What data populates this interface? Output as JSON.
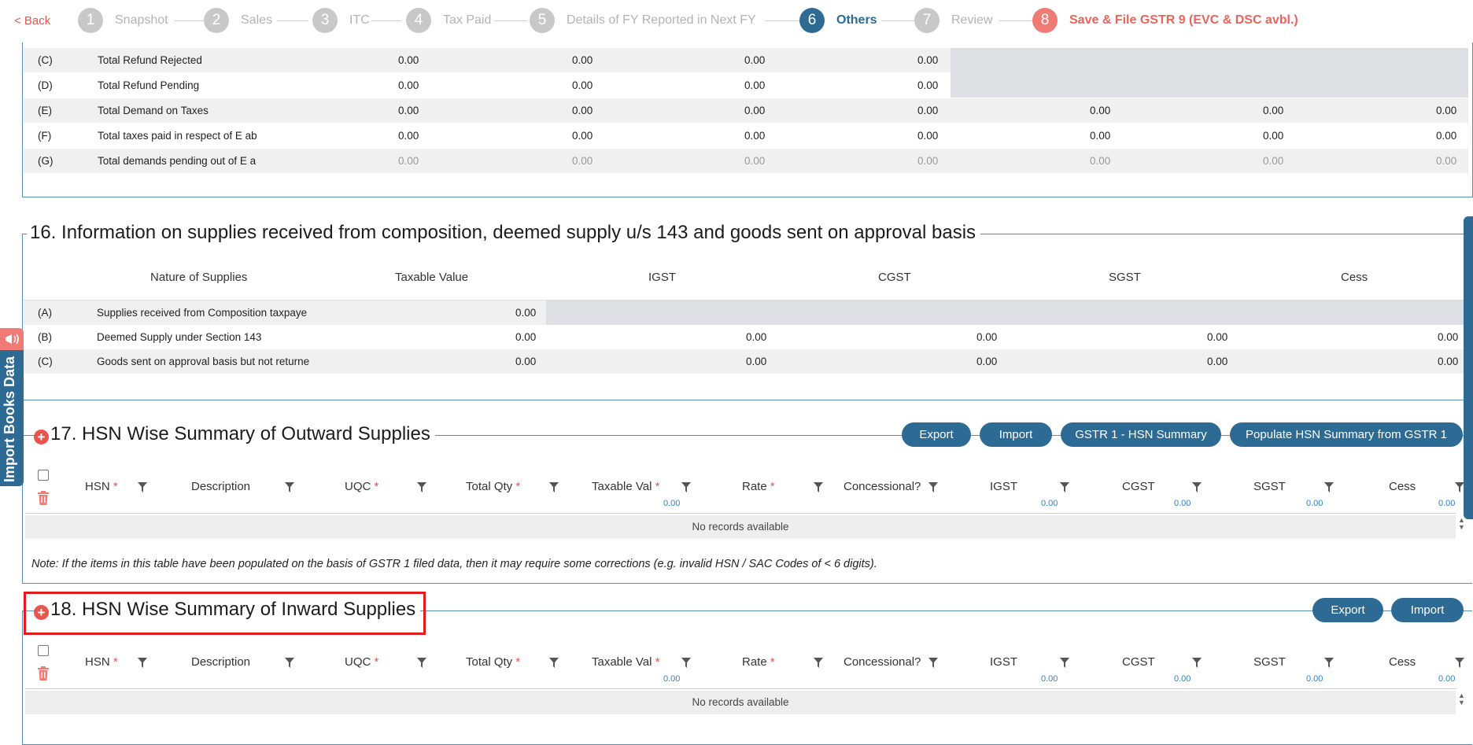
{
  "stepper": {
    "back": "< Back",
    "steps": [
      {
        "num": "1",
        "label": "Snapshot"
      },
      {
        "num": "2",
        "label": "Sales"
      },
      {
        "num": "3",
        "label": "ITC"
      },
      {
        "num": "4",
        "label": "Tax Paid"
      },
      {
        "num": "5",
        "label": "Details of FY Reported in Next FY"
      },
      {
        "num": "6",
        "label": "Others"
      },
      {
        "num": "7",
        "label": "Review"
      },
      {
        "num": "8",
        "label": "Save & File GSTR 9 (EVC & DSC avbl.)"
      }
    ],
    "active_step": "6",
    "colors": {
      "active": "#2d6a94",
      "inactive": "#c8c8c8",
      "final": "#f07b74"
    }
  },
  "table15": {
    "rows": [
      {
        "code": "(C)",
        "label": "Total Refund Rejected",
        "values": [
          "0.00",
          "0.00",
          "0.00",
          "0.00"
        ]
      },
      {
        "code": "(D)",
        "label": "Total Refund Pending",
        "values": [
          "0.00",
          "0.00",
          "0.00",
          "0.00"
        ]
      },
      {
        "code": "(E)",
        "label": "Total Demand on Taxes",
        "values": [
          "0.00",
          "0.00",
          "0.00",
          "0.00",
          "0.00",
          "0.00",
          "0.00"
        ]
      },
      {
        "code": "(F)",
        "label": "Total taxes paid in respect of E ab",
        "values": [
          "0.00",
          "0.00",
          "0.00",
          "0.00",
          "0.00",
          "0.00",
          "0.00"
        ]
      },
      {
        "code": "(G)",
        "label": "Total demands pending out of E a",
        "values": [
          "0.00",
          "0.00",
          "0.00",
          "0.00",
          "0.00",
          "0.00",
          "0.00"
        ]
      }
    ]
  },
  "section16": {
    "title": "16. Information on supplies received from composition, deemed supply u/s 143 and goods sent on approval basis",
    "headers": [
      "Nature of Supplies",
      "Taxable Value",
      "IGST",
      "CGST",
      "SGST",
      "Cess"
    ],
    "rows": [
      {
        "code": "(A)",
        "label": "Supplies received from Composition taxpaye",
        "values": [
          "0.00"
        ]
      },
      {
        "code": "(B)",
        "label": "Deemed Supply under Section 143",
        "values": [
          "0.00",
          "0.00",
          "0.00",
          "0.00",
          "0.00"
        ]
      },
      {
        "code": "(C)",
        "label": "Goods sent on approval basis but not returne",
        "values": [
          "0.00",
          "0.00",
          "0.00",
          "0.00",
          "0.00"
        ]
      }
    ]
  },
  "section17": {
    "title": "17. HSN Wise Summary of Outward Supplies",
    "buttons": {
      "export": "Export",
      "import": "Import",
      "gstr1": "GSTR 1 - HSN Summary",
      "populate": "Populate HSN Summary from GSTR 1"
    },
    "no_records": "No records available",
    "note": "Note: If the items in this table have been populated on the basis of GSTR 1 filed data, then it may require some corrections (e.g. invalid HSN / SAC Codes of < 6 digits)."
  },
  "section18": {
    "title": "18. HSN Wise Summary of Inward Supplies",
    "buttons": {
      "export": "Export",
      "import": "Import"
    },
    "no_records": "No records available"
  },
  "hsn_grid": {
    "columns": [
      {
        "label": "HSN",
        "required": "*"
      },
      {
        "label": "Description",
        "required": ""
      },
      {
        "label": "UQC",
        "required": "*"
      },
      {
        "label": "Total Qty",
        "required": "*"
      },
      {
        "label": "Taxable Val",
        "required": "*"
      },
      {
        "label": "Rate",
        "required": "*"
      },
      {
        "label": "Concessional?",
        "required": ""
      },
      {
        "label": "IGST",
        "required": ""
      },
      {
        "label": "CGST",
        "required": ""
      },
      {
        "label": "SGST",
        "required": ""
      },
      {
        "label": "Cess",
        "required": ""
      }
    ],
    "totals": {
      "taxable_val": "0.00",
      "igst": "0.00",
      "cgst": "0.00",
      "sgst": "0.00",
      "cess": "0.00"
    }
  },
  "side_tab": {
    "label": "Import Books Data"
  },
  "icons": {
    "funnel": "filter-icon",
    "trash": "trash-icon",
    "plus": "add-circle-icon",
    "megaphone": "megaphone-icon"
  }
}
